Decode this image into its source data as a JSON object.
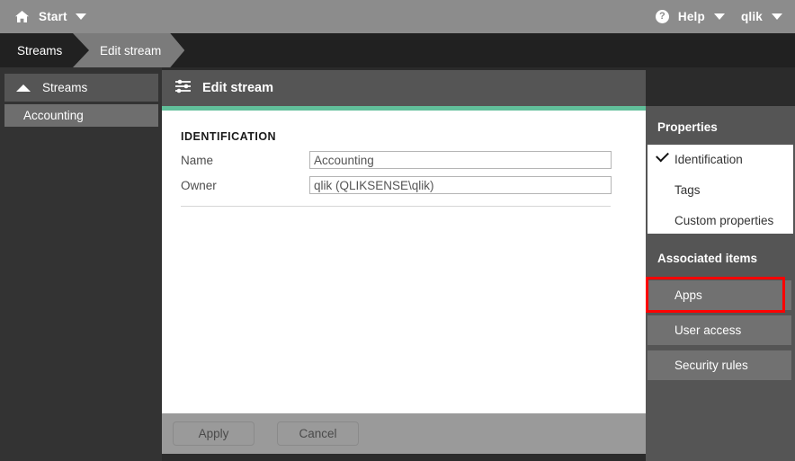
{
  "topbar": {
    "start_label": "Start",
    "start_icon": "home-icon",
    "start_caret_icon": "chevron-down-icon",
    "help_label": "Help",
    "help_icon": "question-circle-icon",
    "help_caret_icon": "chevron-down-icon",
    "user_label": "qlik",
    "user_caret_icon": "chevron-down-icon"
  },
  "breadcrumb": {
    "items": [
      {
        "label": "Streams"
      },
      {
        "label": "Edit stream"
      }
    ]
  },
  "sidebar": {
    "header": {
      "label": "Streams",
      "icon": "chevron-up-icon"
    },
    "items": [
      {
        "label": "Accounting"
      }
    ]
  },
  "card": {
    "header": {
      "title": "Edit stream",
      "icon": "sliders-icon"
    },
    "accent_color": "#61bf9a",
    "section_title": "IDENTIFICATION",
    "fields": [
      {
        "label": "Name",
        "value": "Accounting",
        "placeholder": "Name"
      },
      {
        "label": "Owner",
        "value": "qlik (QLIKSENSE\\qlik)",
        "placeholder": "Owner"
      }
    ],
    "footer": {
      "apply_label": "Apply",
      "cancel_label": "Cancel"
    }
  },
  "right_panel": {
    "properties_title": "Properties",
    "properties": [
      {
        "label": "Identification",
        "selected": true
      },
      {
        "label": "Tags",
        "selected": false
      },
      {
        "label": "Custom properties",
        "selected": false
      }
    ],
    "associated_title": "Associated items",
    "associated_items": [
      {
        "label": "Apps",
        "highlighted": true
      },
      {
        "label": "User access",
        "highlighted": false
      },
      {
        "label": "Security rules",
        "highlighted": false
      }
    ],
    "highlight_color": "#ff0000"
  }
}
